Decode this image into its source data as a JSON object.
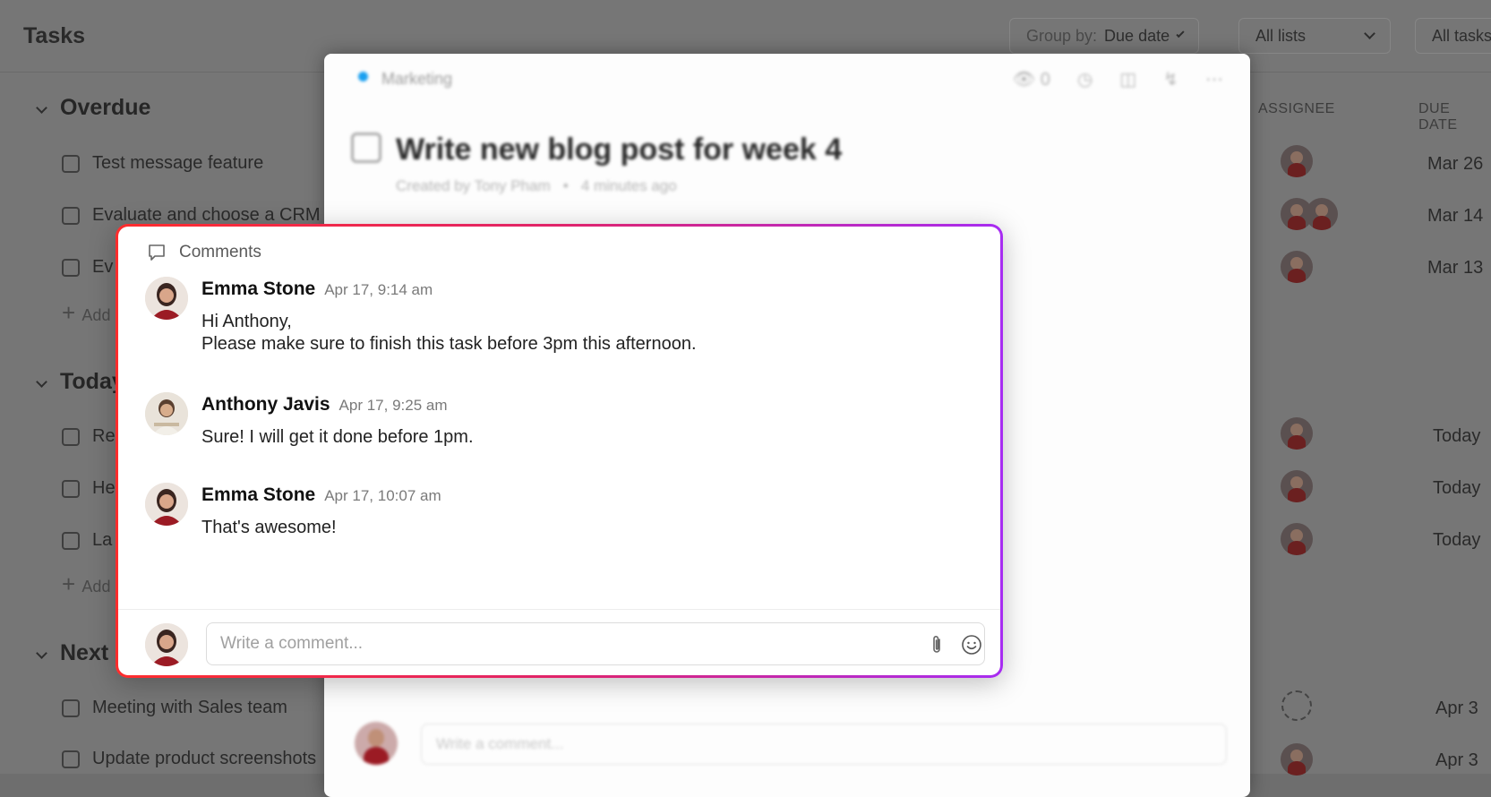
{
  "app": {
    "title": "Tasks"
  },
  "toolbar": {
    "group_by_label": "Group by:",
    "group_by_value": "Due date",
    "lists_filter": "All lists",
    "tasks_filter": "All tasks"
  },
  "columns": {
    "assignee": "ASSIGNEE",
    "due_date": "DUE DATE"
  },
  "sections": [
    {
      "label": "Overdue",
      "tasks": [
        "Test message feature",
        "Evaluate and choose a CRM",
        "Ev"
      ],
      "add_label": "Add"
    },
    {
      "label": "Today",
      "tasks": [
        "Re",
        "He",
        "La"
      ],
      "add_label": "Add"
    },
    {
      "label": "Next",
      "tasks": [
        "Meeting with Sales team",
        "Update product screenshots"
      ]
    }
  ],
  "due_dates": [
    "Mar 26",
    "Mar 14",
    "Mar 13",
    "Today",
    "Today",
    "Today",
    "Apr 3",
    "Apr 3"
  ],
  "task_panel": {
    "list_name": "Marketing",
    "list_color": "#1aa0f0",
    "watchers_count": "0",
    "title": "Write new blog post for week 4",
    "created_by": "Created by Tony Pham",
    "created_ago": "4 minutes ago",
    "comment_placeholder": "Write a comment..."
  },
  "comments_card": {
    "header": "Comments",
    "gradient_start": "#ff2d2d",
    "gradient_end": "#a72cf2",
    "comments": [
      {
        "author": "Emma Stone",
        "time": "Apr 17, 9:14 am",
        "lines": [
          "Hi Anthony,",
          "Please make sure to finish this task before 3pm this afternoon."
        ]
      },
      {
        "author": "Anthony Javis",
        "time": "Apr 17, 9:25 am",
        "lines": [
          "Sure! I will get it done before 1pm."
        ]
      },
      {
        "author": "Emma Stone",
        "time": "Apr 17, 10:07 am",
        "lines": [
          "That's awesome!"
        ]
      }
    ],
    "input_placeholder": "Write a comment...",
    "attach_icon": "paperclip-icon",
    "emoji_icon": "smiley-icon"
  }
}
